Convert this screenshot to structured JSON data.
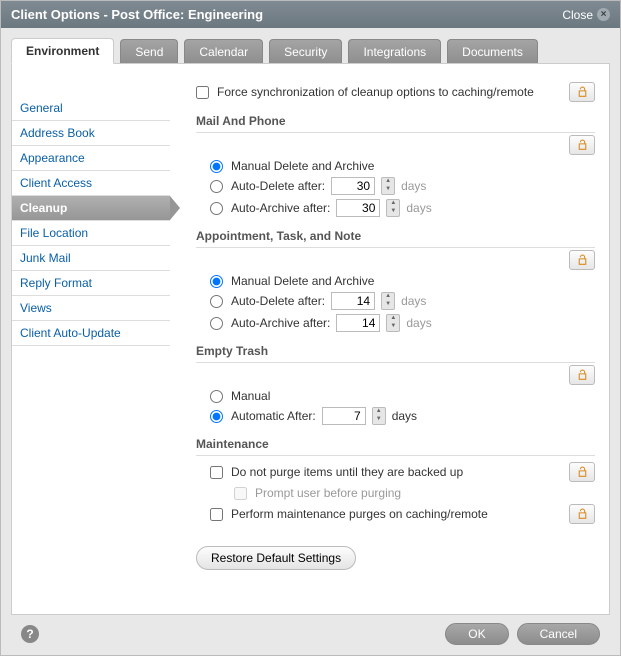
{
  "title": "Client Options - Post Office: Engineering",
  "close_label": "Close",
  "tabs": [
    "Environment",
    "Send",
    "Calendar",
    "Security",
    "Integrations",
    "Documents"
  ],
  "sidebar": {
    "items": [
      "General",
      "Address Book",
      "Appearance",
      "Client Access",
      "Cleanup",
      "File Location",
      "Junk Mail",
      "Reply Format",
      "Views",
      "Client Auto-Update"
    ]
  },
  "force_sync_label": "Force synchronization of cleanup options to caching/remote",
  "force_sync_checked": false,
  "sections": {
    "mail_phone": {
      "title": "Mail And Phone",
      "manual_label": "Manual Delete and Archive",
      "auto_delete_label": "Auto-Delete after:",
      "auto_delete_value": "30",
      "auto_archive_label": "Auto-Archive after:",
      "auto_archive_value": "30",
      "days_label": "days",
      "selected": "manual"
    },
    "appt": {
      "title": "Appointment, Task, and Note",
      "manual_label": "Manual Delete and Archive",
      "auto_delete_label": "Auto-Delete after:",
      "auto_delete_value": "14",
      "auto_archive_label": "Auto-Archive after:",
      "auto_archive_value": "14",
      "days_label": "days",
      "selected": "manual"
    },
    "trash": {
      "title": "Empty Trash",
      "manual_label": "Manual",
      "auto_label": "Automatic After:",
      "auto_value": "7",
      "days_label": "days",
      "selected": "auto"
    },
    "maint": {
      "title": "Maintenance",
      "no_purge_label": "Do not purge items until they are backed up",
      "prompt_label": "Prompt user before purging",
      "caching_label": "Perform maintenance purges on caching/remote"
    }
  },
  "restore_label": "Restore Default Settings",
  "ok_label": "OK",
  "cancel_label": "Cancel"
}
